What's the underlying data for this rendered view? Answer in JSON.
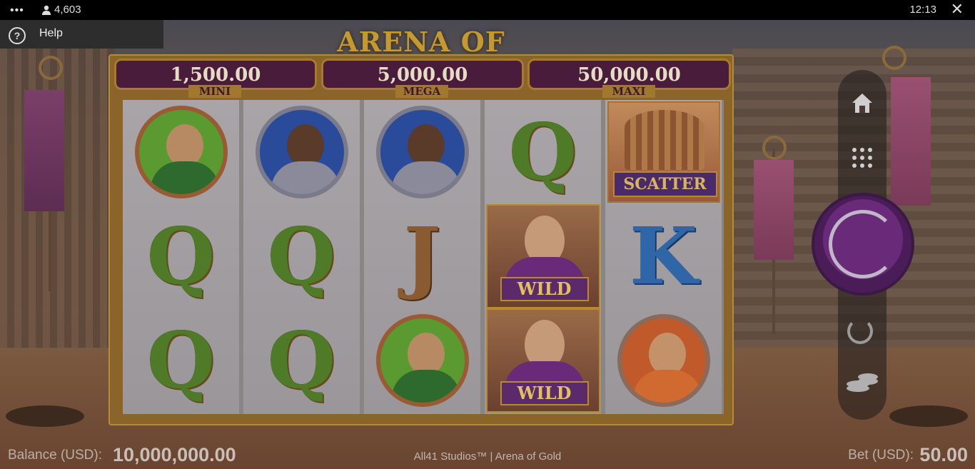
{
  "topbar": {
    "menu_dots": "•••",
    "player_count": "4,603",
    "time": "12:13",
    "close_glyph": "✕"
  },
  "help": {
    "label": "Help",
    "icon_glyph": "?"
  },
  "game": {
    "title": "ARENA OF GOLD",
    "jackpots": [
      {
        "value": "1,500.00",
        "label": "MINI"
      },
      {
        "value": "5,000.00",
        "label": "MEGA"
      },
      {
        "value": "50,000.00",
        "label": "MAXI"
      }
    ],
    "symbol_texts": {
      "wild": "WILD",
      "scatter": "SCATTER"
    },
    "reels": [
      [
        "green-warrior",
        "Q",
        "Q"
      ],
      [
        "blue-warrior",
        "Q",
        "Q"
      ],
      [
        "blue-warrior",
        "J",
        "green-warrior"
      ],
      [
        "Q",
        "wild",
        "wild"
      ],
      [
        "scatter",
        "K",
        "orange-warrior"
      ]
    ]
  },
  "controls": {
    "home_icon": "home-icon",
    "menu_icon": "grid-icon",
    "spin_icon": "spin-icon",
    "autoplay_icon": "autoplay-icon",
    "bet_icon": "coins-icon"
  },
  "footer": {
    "balance_label": "Balance (USD):",
    "balance_value": "10,000,000.00",
    "studio_text": "All41 Studios™ | Arena of Gold",
    "bet_label": "Bet (USD):",
    "bet_value": "50.00"
  },
  "colors": {
    "frame": "#8a6428",
    "jackpot_bg": "#4a1c3c",
    "spin_button": "#6a2a7a"
  }
}
